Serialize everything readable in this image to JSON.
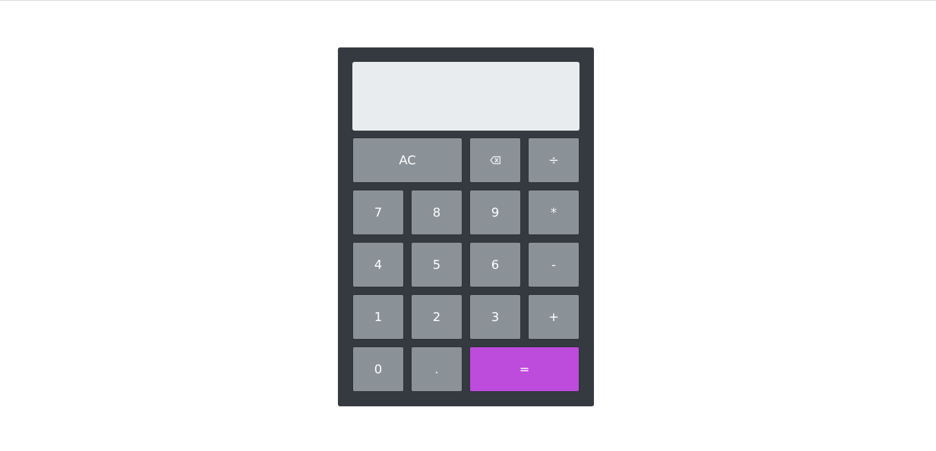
{
  "display": {
    "value": ""
  },
  "keys": {
    "clear": "AC",
    "divide": "÷",
    "seven": "7",
    "eight": "8",
    "nine": "9",
    "multiply": "*",
    "four": "4",
    "five": "5",
    "six": "6",
    "subtract": "-",
    "one": "1",
    "two": "2",
    "three": "3",
    "add": "+",
    "zero": "0",
    "decimal": ".",
    "equals": "="
  },
  "icons": {
    "backspace": "backspace-icon"
  },
  "colors": {
    "body": "#343a40",
    "display": "#e8ecee",
    "key": "#8a9197",
    "equals": "#bd4bdb",
    "key_text": "#ffffff"
  }
}
